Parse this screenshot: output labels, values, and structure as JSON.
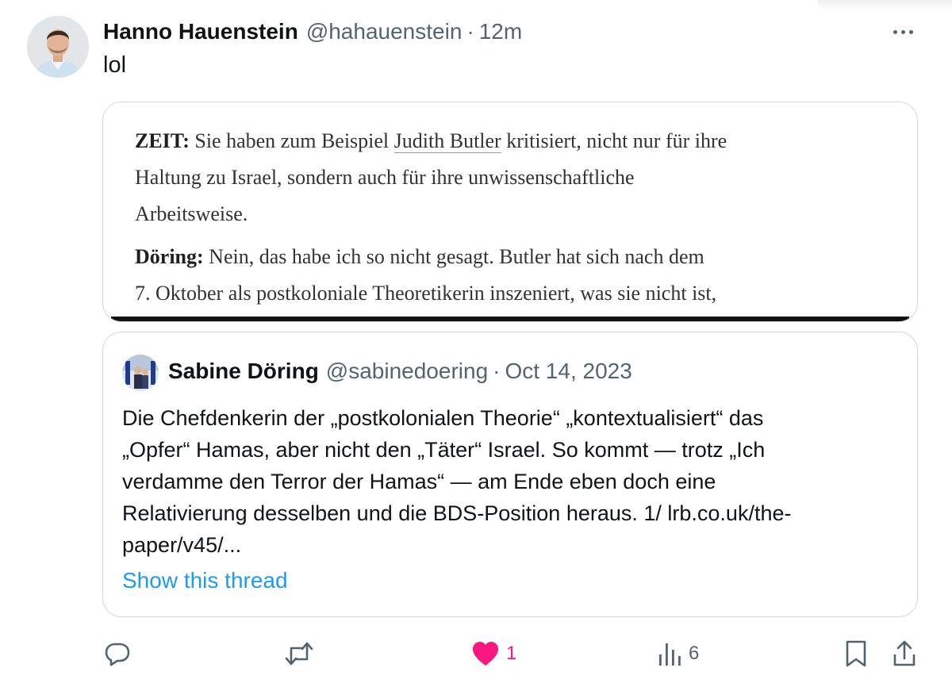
{
  "tweet": {
    "author_name": "Hanno Hauenstein",
    "handle": "@hahauenstein",
    "separator": "·",
    "time": "12m",
    "text": "lol",
    "more_icon": "more-horizontal-icon"
  },
  "media": {
    "paragraph1": {
      "speaker": "ZEIT:",
      "text_before_link": " Sie haben zum Beispiel ",
      "link_text": "Judith Butler",
      "text_after_link": " kritisiert, nicht nur für ihre",
      "line2": "Haltung zu Israel, sondern auch für ihre unwissenschaftliche",
      "line3": "Arbeitsweise."
    },
    "paragraph2": {
      "speaker": "Döring:",
      "line1_rest": " Nein, das habe ich so nicht gesagt. Butler hat sich nach dem",
      "line2": "7. Oktober als postkoloniale Theoretikerin inszeniert, was sie nicht ist,"
    }
  },
  "quoted": {
    "author_name": "Sabine Döring",
    "handle": "@sabinedoering",
    "separator": "·",
    "date": "Oct 14, 2023",
    "lines": [
      "Die Chefdenkerin der „postkolonialen Theorie“ „kontextualisiert“ das",
      "„Opfer“ Hamas, aber nicht den „Täter“ Israel. So kommt — trotz „Ich",
      "verdamme den Terror der Hamas“ — am Ende eben doch eine",
      "Relativierung desselben und die BDS-Position heraus. 1/ lrb.co.uk/the-",
      "paper/v45/..."
    ],
    "show_thread": "Show this thread"
  },
  "actions": {
    "reply_icon": "reply-icon",
    "retweet_icon": "retweet-icon",
    "like_icon": "heart-filled-icon",
    "like_count": "1",
    "views_icon": "views-bar-chart-icon",
    "views_count": "6",
    "bookmark_icon": "bookmark-icon",
    "share_icon": "share-icon"
  },
  "colors": {
    "text": "#0f1419",
    "secondary": "#536471",
    "link": "#1d9bf0",
    "like": "#f91880",
    "border": "#cfd9de"
  }
}
